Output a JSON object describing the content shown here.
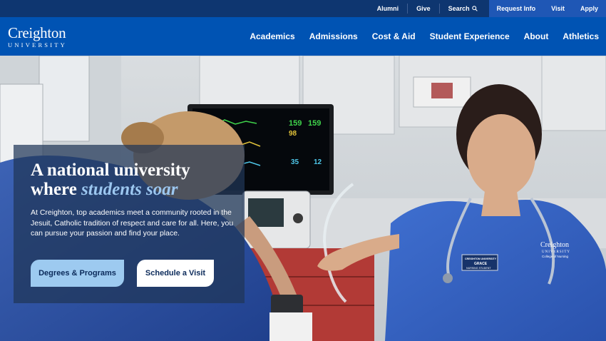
{
  "utility_nav": {
    "alumni": "Alumni",
    "give": "Give",
    "search": "Search",
    "request_info": "Request Info",
    "visit": "Visit",
    "apply": "Apply"
  },
  "logo": {
    "wordmark": "Creighton",
    "subtitle": "UNIVERSITY"
  },
  "main_nav": {
    "items": [
      "Academics",
      "Admissions",
      "Cost & Aid",
      "Student Experience",
      "About",
      "Athletics"
    ]
  },
  "hero": {
    "title_line1": "A national university",
    "title_line2_prefix": "where ",
    "title_line2_accent": "students soar",
    "body": "At Creighton, top academics meet a community rooted in the Jesuit, Catholic tradition of respect and care for all. Here, you can pursue your passion and find your place.",
    "primary_button": "Degrees & Programs",
    "secondary_button": "Schedule a Visit",
    "photo_text": {
      "name_badge_school": "CREIGHTON UNIVERSITY",
      "name_badge_name": "GRACE",
      "name_badge_role": "NURSING STUDENT",
      "shirt_logo_line1": "Creighton",
      "shirt_logo_line2": "UNIVERSITY",
      "shirt_logo_line3": "College of Nursing",
      "monitor_values": [
        "159",
        "159",
        "98",
        "35",
        "12"
      ]
    }
  },
  "colors": {
    "utility_bar": "#0e3670",
    "header": "#0053b3",
    "accent_light_blue": "#9dcaf0",
    "card_overlay": "#203658"
  }
}
